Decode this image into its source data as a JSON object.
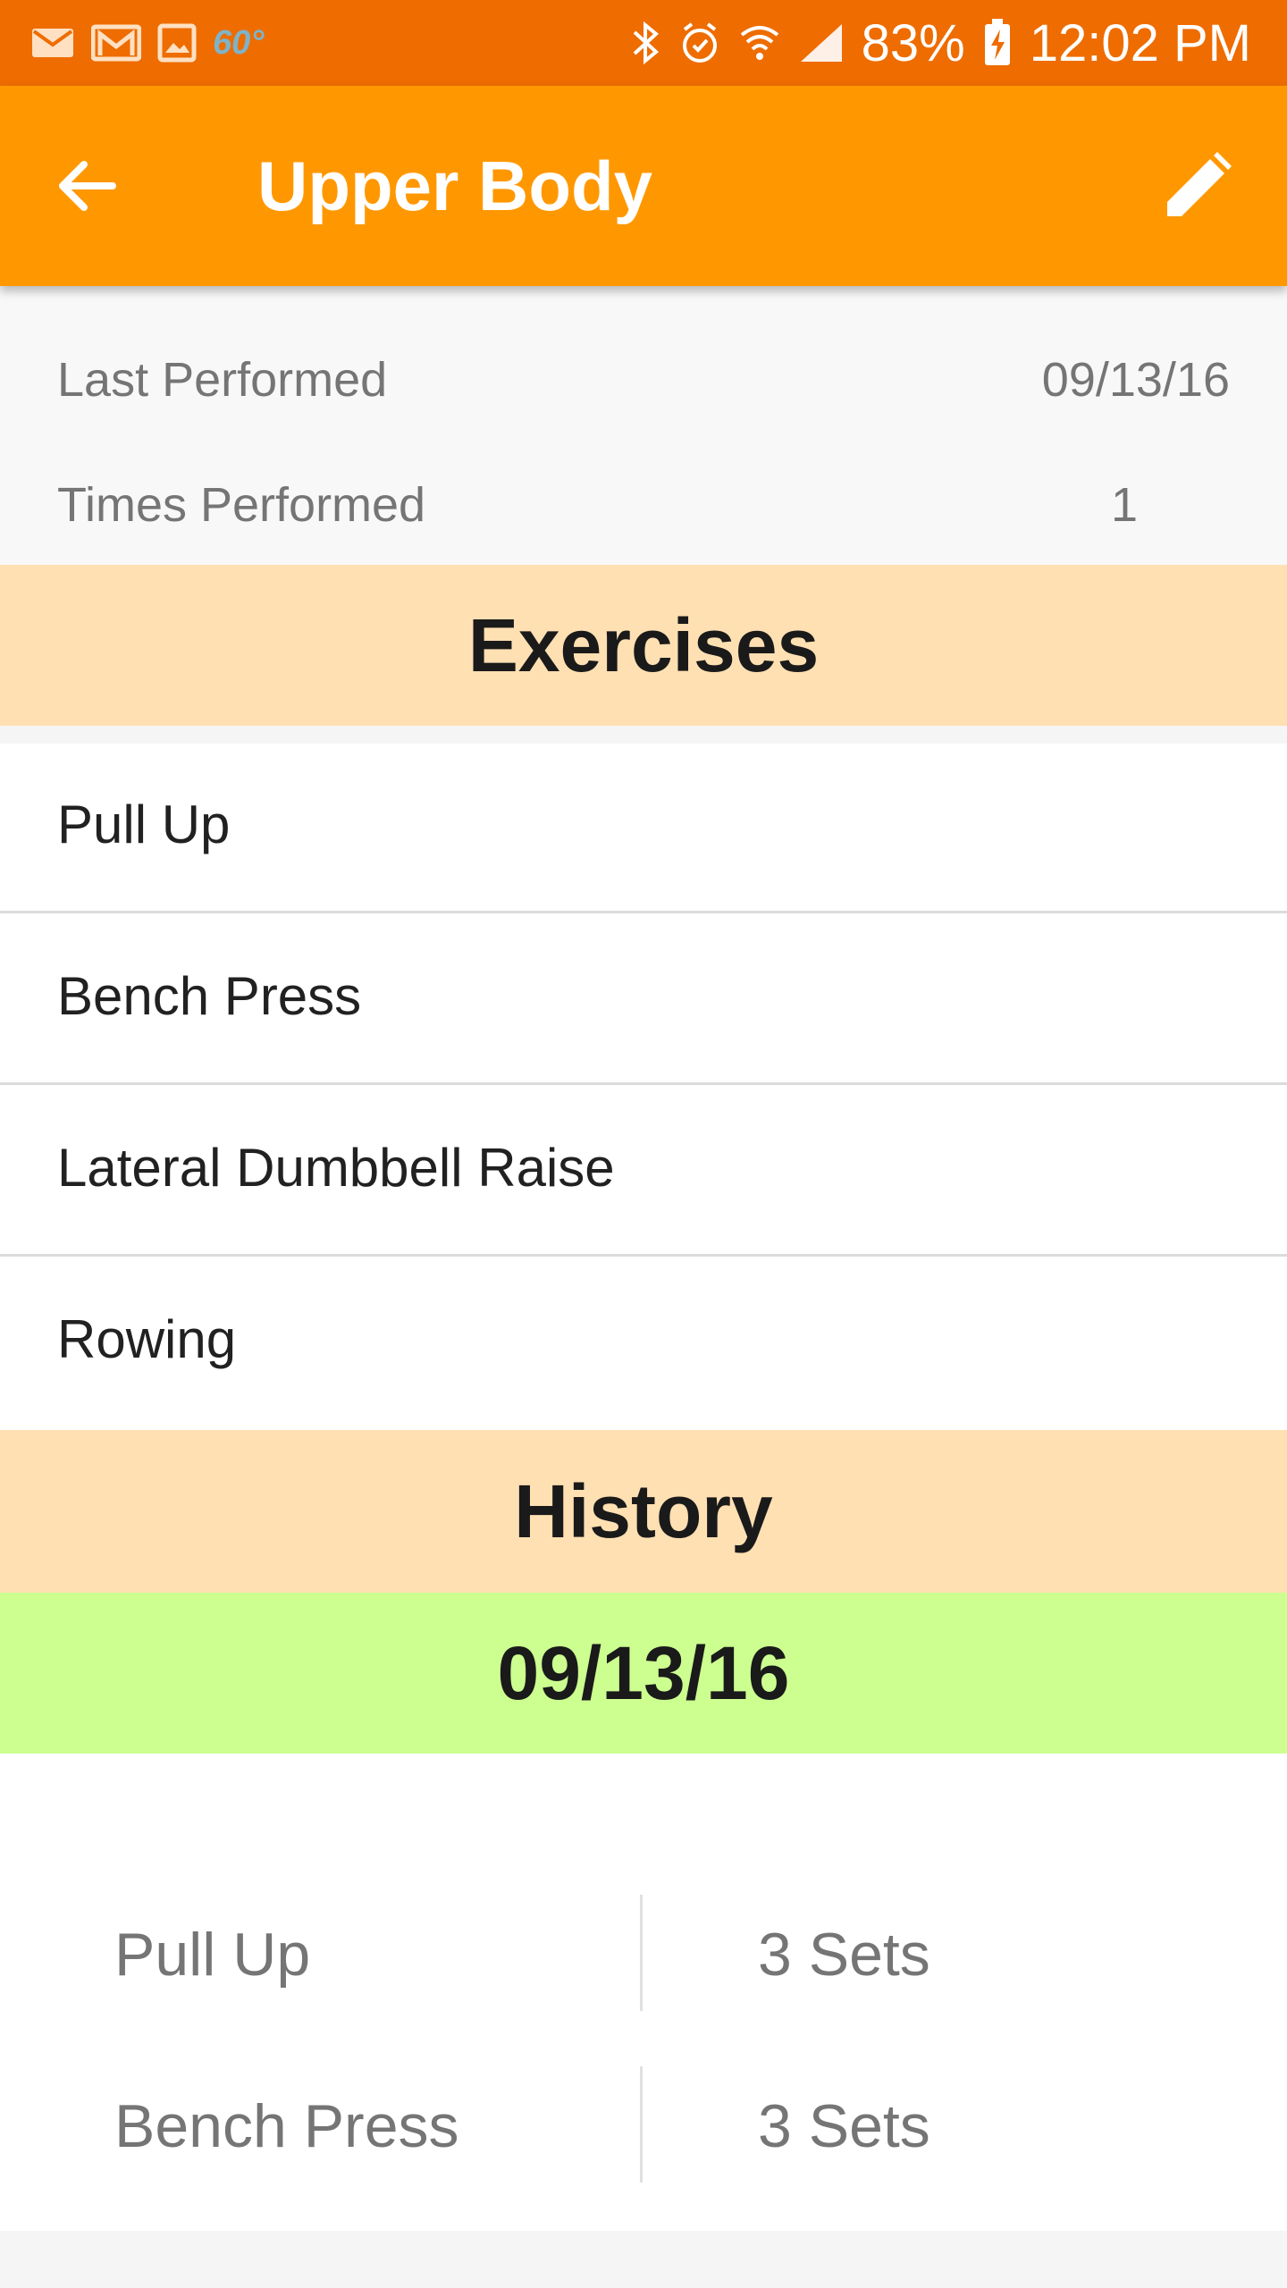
{
  "status_bar": {
    "temperature": "60°",
    "battery": "83%",
    "time": "12:02 PM",
    "icons": [
      "mail-icon",
      "gmail-icon",
      "gallery-icon",
      "bluetooth-icon",
      "alarm-icon",
      "wifi-icon",
      "signal-icon",
      "battery-charging-icon"
    ]
  },
  "app_bar": {
    "title": "Upper Body",
    "back_icon": "arrow-back-icon",
    "edit_icon": "pencil-icon"
  },
  "info": {
    "last_performed_label": "Last Performed",
    "last_performed_value": "09/13/16",
    "times_performed_label": "Times Performed",
    "times_performed_value": "1"
  },
  "exercises": {
    "header": "Exercises",
    "items": [
      "Pull Up",
      "Bench Press",
      "Lateral Dumbbell Raise",
      "Rowing"
    ]
  },
  "history": {
    "header": "History",
    "sessions": [
      {
        "date": "09/13/16",
        "entries": [
          {
            "exercise": "Pull Up",
            "sets": "3 Sets"
          },
          {
            "exercise": "Bench Press",
            "sets": "3 Sets"
          }
        ]
      }
    ]
  },
  "colors": {
    "status_bar": "#EE6C00",
    "app_bar": "#FF9800",
    "section_header": "#FFE0B2",
    "date_header": "#CCFF90"
  }
}
